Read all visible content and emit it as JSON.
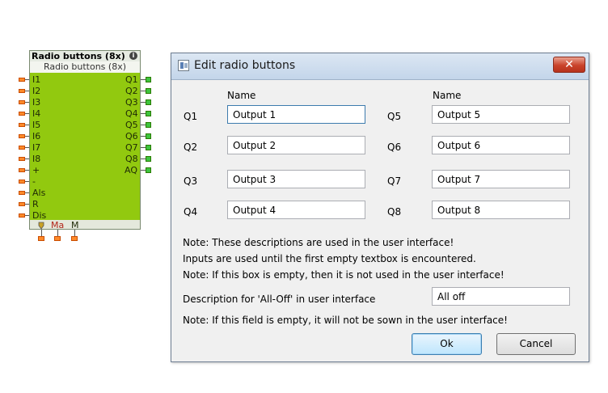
{
  "block": {
    "title": "Radio buttons (8x)",
    "subtitle": "Radio buttons (8x)",
    "info_icon": "info-icon",
    "inputs": [
      "I1",
      "I2",
      "I3",
      "I4",
      "I5",
      "I6",
      "I7",
      "I8",
      "+",
      "-",
      "Als",
      "R",
      "Dis"
    ],
    "outputs": [
      "Q1",
      "Q2",
      "Q3",
      "Q4",
      "Q5",
      "Q6",
      "Q7",
      "Q8",
      "AQ"
    ],
    "params": [
      "Ma",
      "M"
    ],
    "colors": {
      "body": "#92c90f",
      "input_pin": "#ff8a2a",
      "output_pin": "#3ec43e"
    }
  },
  "dialog": {
    "title": "Edit radio buttons",
    "close_label": "✕",
    "name_header_left": "Name",
    "name_header_right": "Name",
    "rows": [
      {
        "label": "Q1",
        "value": "Output 1"
      },
      {
        "label": "Q2",
        "value": "Output 2"
      },
      {
        "label": "Q3",
        "value": "Output 3"
      },
      {
        "label": "Q4",
        "value": "Output 4"
      },
      {
        "label": "Q5",
        "value": "Output 5"
      },
      {
        "label": "Q6",
        "value": "Output 6"
      },
      {
        "label": "Q7",
        "value": "Output 7"
      },
      {
        "label": "Q8",
        "value": "Output 8"
      }
    ],
    "note1": "Note: These descriptions are used in the user interface!",
    "note2": "Inputs are used until the first empty textbox is encountered.",
    "note3": "Note: If this box is empty, then it is not used in the user interface!",
    "alloff_label": "Description for 'All-Off' in user interface",
    "alloff_value": "All off",
    "note4": "Note: If this field is empty, it will not be sown in the user interface!",
    "ok_label": "Ok",
    "cancel_label": "Cancel"
  }
}
